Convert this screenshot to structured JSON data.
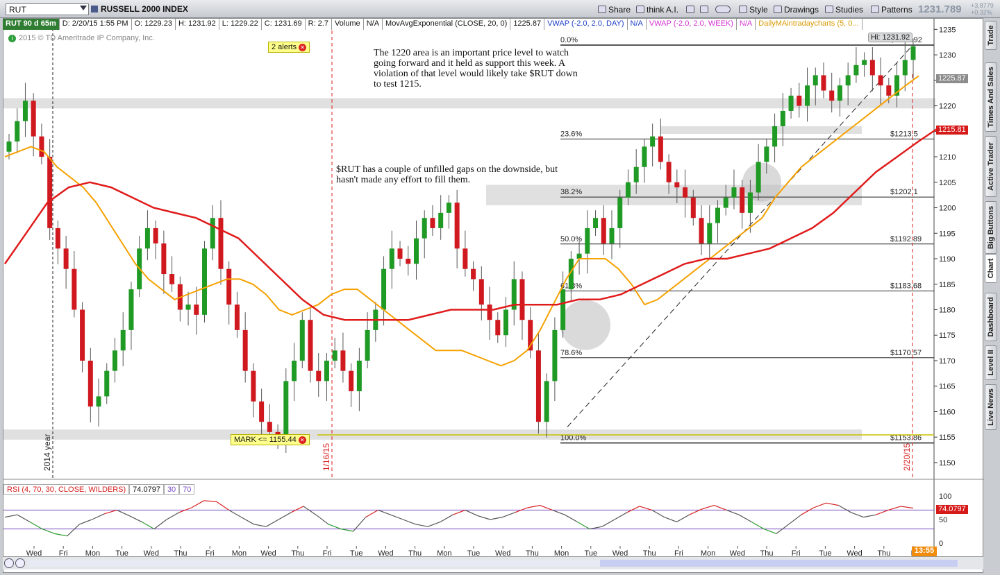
{
  "toolbar": {
    "symbol": "RUT",
    "index_name": "RUSSELL 2000 INDEX",
    "buttons": [
      {
        "label": "Share",
        "icon": "share-icon"
      },
      {
        "label": "think A.I.",
        "icon": "search-icon"
      },
      {
        "label": "",
        "icon": "tools-icon"
      },
      {
        "label": "",
        "icon": "wrench-icon"
      },
      {
        "label": "",
        "icon": "eye-icon"
      },
      {
        "label": "Style",
        "icon": "style-icon"
      },
      {
        "label": "Drawings",
        "icon": "pencil-icon"
      },
      {
        "label": "Studies",
        "icon": "studies-icon"
      },
      {
        "label": "Patterns",
        "icon": "patterns-icon"
      }
    ],
    "last_price": "1231.789",
    "change_abs": "+3.8779",
    "change_pct": "+0.32%"
  },
  "info_strip": {
    "symbol_period": "RUT 90 d 65m",
    "date": "D: 2/20/15 1:55 PM",
    "open": "O: 1229.23",
    "high": "H: 1231.92",
    "low": "L: 1229.22",
    "close": "C: 1231.69",
    "range": "R: 2.7",
    "volume_label": "Volume",
    "volume_value": "N/A",
    "mov_avg": "MovAvgExponential (CLOSE, 20, 0)",
    "mov_avg_value": "1225.87",
    "vwap_day": "VWAP (-2.0, 2.0, DAY)",
    "vwap_day_value": "N/A",
    "vwap_week": "VWAP (-2.0, 2.0, WEEK)",
    "vwap_week_value": "N/A",
    "daily_ma": "DailyMAintradaycharts (5, 0..."
  },
  "copyright": "2015 © TD Ameritrade IP Company, Inc.",
  "alerts_label": "2 alerts",
  "mark_callout": "MARK <= 1155.44",
  "notes": {
    "note1": "The 1220 area is an important price level to watch going forward and it held as support this week.  A violation of that level would likely take $RUT down to test 1215.",
    "note2": "$RUT has a couple of unfilled gaps on the downside, but hasn't made any effort to fill them."
  },
  "vertical_labels": {
    "year": "2014 year",
    "date1": "1/16/15",
    "date2": "2/20/15"
  },
  "hi_badge": "Hi: 1231.92",
  "price_tags": {
    "ma20": "1225.87",
    "ma50": "1215.81",
    "rsi": "74.0797"
  },
  "fib_levels": [
    {
      "pct": "0.0%",
      "price": "1231.92",
      "value": 1231.92
    },
    {
      "pct": "23.6%",
      "price": "1213.5",
      "value": 1213.5
    },
    {
      "pct": "38.2%",
      "price": "1202.1",
      "value": 1202.1
    },
    {
      "pct": "50.0%",
      "price": "1192.89",
      "value": 1192.89
    },
    {
      "pct": "61.8%",
      "price": "1183.68",
      "value": 1183.68
    },
    {
      "pct": "78.6%",
      "price": "1170.57",
      "value": 1170.57
    },
    {
      "pct": "100.0%",
      "price": "1153.86",
      "value": 1153.86
    }
  ],
  "rsi_strip": {
    "label": "RSI (4, 70, 30, CLOSE, WILDERS)",
    "value": "74.0797",
    "low": "30",
    "high": "70"
  },
  "time_badge": "13:55",
  "side_tabs": [
    "Trade",
    "Times And Sales",
    "Active Trader",
    "Big Buttons",
    "Chart",
    "Dashboard",
    "Level II",
    "Live News"
  ],
  "colors": {
    "up": "#1f9a24",
    "down": "#d0181f",
    "ema20": "#f5a100",
    "ma50": "#e01b1b",
    "sma": "#8a8a8a",
    "rsi_line": "#555555",
    "rsi_ob": "#d82020",
    "rsi_os": "#2a9a2a"
  },
  "chart_data": {
    "type": "candlestick",
    "title": "RUSSELL 2000 INDEX",
    "ylim": [
      1147,
      1236
    ],
    "y_ticks": [
      1150,
      1155,
      1160,
      1165,
      1170,
      1175,
      1180,
      1185,
      1190,
      1195,
      1200,
      1205,
      1210,
      1215,
      1220,
      1225,
      1230,
      1235
    ],
    "x_labels": [
      "Wed",
      "Fri",
      "Mon",
      "Tue",
      "Wed",
      "Thu",
      "Fri",
      "Mon",
      "Wed",
      "Thu",
      "Fri",
      "Tue",
      "Wed",
      "Thu",
      "Mon",
      "Tue",
      "Wed",
      "Thu",
      "Mon",
      "Tue",
      "Wed",
      "Thu",
      "Fri",
      "Mon",
      "Wed",
      "Thu",
      "Fri",
      "Tue",
      "Wed",
      "Thu",
      "F"
    ],
    "closes": [
      1213,
      1217,
      1221,
      1214,
      1210,
      1196,
      1192,
      1188,
      1180,
      1170,
      1161,
      1163,
      1168,
      1172,
      1176,
      1184,
      1192,
      1196,
      1193,
      1187,
      1185,
      1180,
      1181,
      1179,
      1192,
      1198,
      1188,
      1181,
      1176,
      1168,
      1162,
      1158,
      1156,
      1155,
      1166,
      1170,
      1178,
      1168,
      1166,
      1170,
      1172,
      1168,
      1164,
      1170,
      1176,
      1180,
      1188,
      1192,
      1190,
      1189,
      1194,
      1198,
      1196,
      1199,
      1201,
      1192,
      1188,
      1186,
      1181,
      1178,
      1175,
      1180,
      1186,
      1178,
      1172,
      1158,
      1166,
      1176,
      1184,
      1190,
      1191,
      1196,
      1198,
      1193,
      1196,
      1202,
      1205,
      1208,
      1212,
      1214,
      1209,
      1205,
      1204,
      1202,
      1198,
      1193,
      1197,
      1200,
      1202,
      1204,
      1199,
      1203,
      1209,
      1212,
      1216,
      1219,
      1222,
      1220,
      1224,
      1226,
      1223,
      1221,
      1224,
      1226,
      1228,
      1229,
      1226,
      1224,
      1222,
      1226,
      1229,
      1231.7
    ],
    "ema20": [
      1210,
      1211,
      1212,
      1211,
      1208,
      1206,
      1204,
      1201,
      1197,
      1193,
      1189,
      1186,
      1184,
      1182,
      1183,
      1184,
      1185,
      1186,
      1186,
      1185,
      1183,
      1180,
      1179,
      1180,
      1181,
      1183,
      1184,
      1184,
      1182,
      1180,
      1178,
      1176,
      1174,
      1172,
      1172,
      1172,
      1171,
      1170,
      1169,
      1170,
      1172,
      1176,
      1181,
      1186,
      1190,
      1190,
      1190,
      1188,
      1185,
      1181,
      1182,
      1184,
      1186,
      1188,
      1190,
      1192,
      1194,
      1196,
      1198,
      1202,
      1205,
      1208,
      1210,
      1212,
      1214,
      1216,
      1218,
      1220,
      1222,
      1224,
      1225.87
    ],
    "ma50": [
      1189,
      1195,
      1201,
      1204,
      1205,
      1204,
      1202,
      1200,
      1199,
      1198,
      1196,
      1194,
      1190,
      1186,
      1182,
      1179,
      1178,
      1178,
      1178,
      1178,
      1179,
      1180,
      1180,
      1180,
      1181,
      1181,
      1181,
      1182,
      1182,
      1183,
      1185,
      1187,
      1189,
      1190,
      1190,
      1191,
      1192,
      1194,
      1196,
      1199,
      1203,
      1207,
      1210,
      1213,
      1215.81
    ],
    "rsi": [
      55,
      60,
      45,
      30,
      20,
      15,
      40,
      50,
      62,
      70,
      58,
      45,
      30,
      50,
      65,
      75,
      90,
      88,
      70,
      55,
      40,
      35,
      50,
      65,
      78,
      60,
      40,
      30,
      25,
      55,
      70,
      60,
      50,
      40,
      35,
      45,
      60,
      70,
      58,
      50,
      55,
      65,
      75,
      80,
      70,
      60,
      45,
      30,
      35,
      50,
      65,
      78,
      70,
      55,
      45,
      60,
      72,
      80,
      70,
      60,
      45,
      30,
      20,
      40,
      60,
      75,
      85,
      80,
      65,
      55,
      60,
      70,
      78,
      74.08
    ],
    "rsi_levels": {
      "overbought": 70,
      "oversold": 30
    },
    "rsi_ylim": [
      0,
      100
    ]
  }
}
